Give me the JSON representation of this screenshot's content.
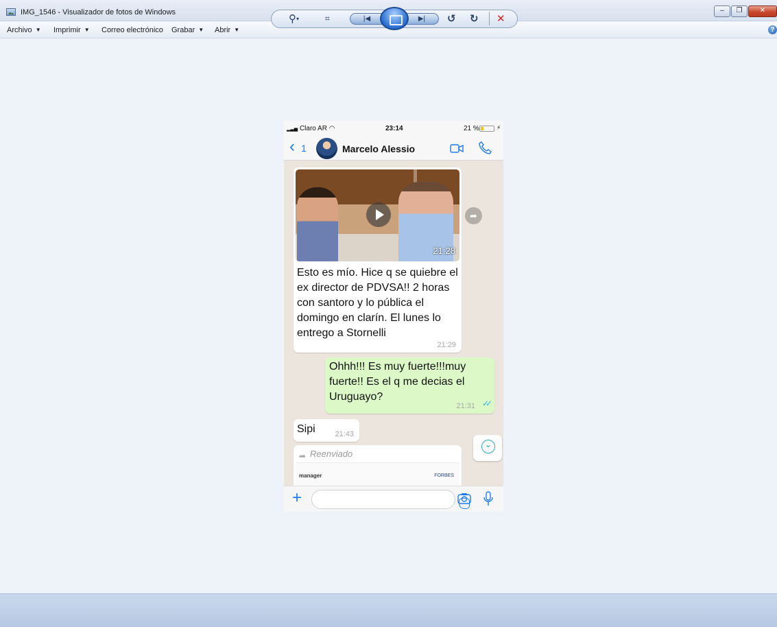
{
  "window": {
    "title": "IMG_1546 - Visualizador de fotos de Windows",
    "controls": {
      "minimize": "–",
      "maximize": "❐",
      "close": "✕"
    }
  },
  "menu": {
    "items": [
      {
        "label": "Archivo",
        "dropdown": "▼"
      },
      {
        "label": "Imprimir",
        "dropdown": "▼"
      },
      {
        "label": "Correo electrónico",
        "dropdown": ""
      },
      {
        "label": "Grabar",
        "dropdown": "▼"
      },
      {
        "label": "Abrir",
        "dropdown": "▼"
      }
    ],
    "help": "?"
  },
  "photo": {
    "status": {
      "carrier": "Claro AR",
      "time": "23:14",
      "battery": "21 %",
      "battery_level": 0.21,
      "charging": "⚡"
    },
    "header": {
      "back_count": "1",
      "contact": "Marcelo Alessio",
      "icons": [
        "video-call-icon",
        "phone-icon"
      ]
    },
    "messages": [
      {
        "direction": "received",
        "type": "video",
        "duration": "21:28",
        "text": "Esto es mío. Hice q se quiebre el ex director de PDVSA!! 2 horas con santoro y lo pública el domingo en clarín. El lunes lo entrego a Stornelli",
        "time": "21:29"
      },
      {
        "direction": "sent",
        "type": "text",
        "text": "Ohhh!!! Es muy fuerte!!!muy fuerte!! Es el q me decias el Uruguayo?",
        "time": "21:31",
        "status": "read"
      },
      {
        "direction": "received",
        "type": "text",
        "text": "Sipi",
        "time": "21:43"
      },
      {
        "direction": "received",
        "type": "document",
        "forwarded_label": "Reenviado",
        "preview_left": "manager",
        "preview_right": "FORBES"
      }
    ]
  },
  "toolbar": {
    "zoom": "⚲",
    "fit": "⌗",
    "previous": "|◀",
    "slideshow": "",
    "next": "▶|",
    "rotate_left": "↺",
    "rotate_right": "↻",
    "delete": "✕"
  },
  "colors": {
    "accent_blue": "#1d7bf2",
    "sent_bubble": "#dcf8c6",
    "chat_background": "#ece5dd",
    "delete_red": "#d6261c"
  }
}
